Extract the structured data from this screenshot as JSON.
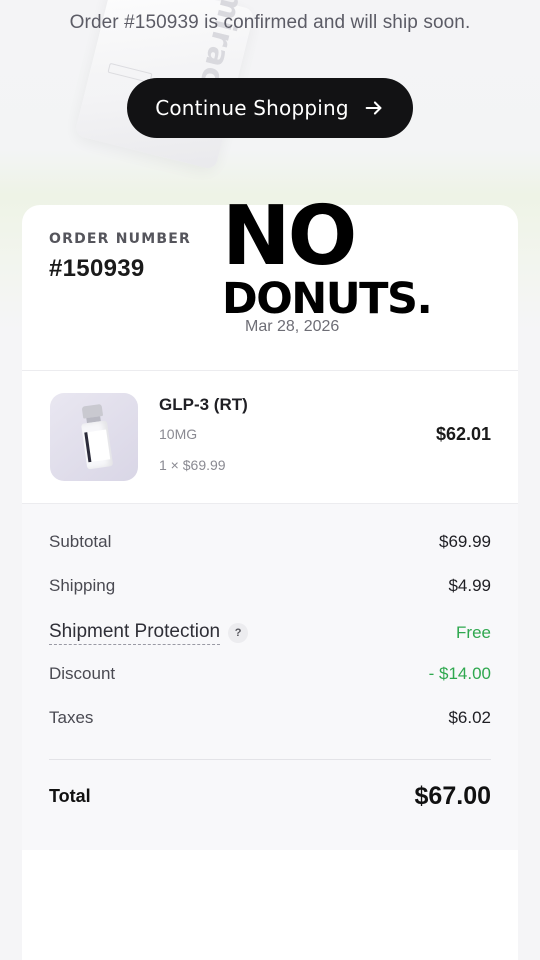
{
  "header": {
    "confirmation_text": "Order #150939 is confirmed and will ship soon.",
    "continue_label": "Continue Shopping",
    "background_mark_text": "mirac"
  },
  "order": {
    "label": "ORDER NUMBER",
    "number": "#150939",
    "date": "Mar 28, 2026"
  },
  "overlay": {
    "line1": "NO",
    "line2": "DONUTS."
  },
  "item": {
    "name": "GLP-3 (RT)",
    "variant": "10MG",
    "quantity_price": "1 × $69.99",
    "price": "$62.01",
    "thumbnail_icon": "vial-icon"
  },
  "summary": {
    "subtotal_label": "Subtotal",
    "subtotal_value": "$69.99",
    "shipping_label": "Shipping",
    "shipping_value": "$4.99",
    "protection_label": "Shipment Protection",
    "protection_help": "?",
    "protection_value": "Free",
    "discount_label": "Discount",
    "discount_value": "- $14.00",
    "taxes_label": "Taxes",
    "taxes_value": "$6.02",
    "total_label": "Total",
    "total_value": "$67.00"
  },
  "colors": {
    "accent_green": "#2fa84f",
    "button_dark": "#121214"
  }
}
